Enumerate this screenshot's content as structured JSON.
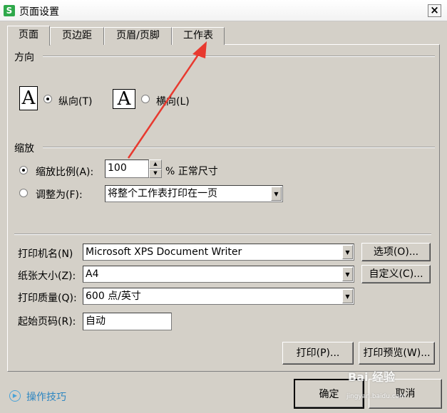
{
  "window": {
    "title": "页面设置",
    "app_icon": "S",
    "close_glyph": "×"
  },
  "tabs": [
    {
      "label": "页面",
      "active": true
    },
    {
      "label": "页边距",
      "active": false
    },
    {
      "label": "页眉/页脚",
      "active": false
    },
    {
      "label": "工作表",
      "active": false
    }
  ],
  "orientation": {
    "section": "方向",
    "icon_letter": "A",
    "portrait": {
      "label": "纵向(T)",
      "selected": true
    },
    "landscape": {
      "label": "横向(L)",
      "selected": false
    }
  },
  "scaling": {
    "section": "缩放",
    "scale": {
      "label": "缩放比例(A):",
      "value": "100",
      "suffix": "% 正常尺寸",
      "selected": true
    },
    "fit": {
      "label": "调整为(F):",
      "value": "将整个工作表打印在一页",
      "selected": false
    }
  },
  "printer": {
    "name_label": "打印机名(N)",
    "name_value": "Microsoft XPS Document Writer",
    "options_button": "选项(O)...",
    "paper_label": "纸张大小(Z):",
    "paper_value": "A4",
    "custom_button": "自定义(C)...",
    "quality_label": "打印质量(Q):",
    "quality_value": "600 点/英寸",
    "start_label": "起始页码(R):",
    "start_value": "自动"
  },
  "actions": {
    "print": "打印(P)...",
    "preview": "打印预览(W)...",
    "ok": "确定",
    "cancel": "取消"
  },
  "help": {
    "label": "操作技巧"
  },
  "watermark": {
    "text": "Bai 经验",
    "sub": "jingyan.baidu.com"
  },
  "colors": {
    "arrow": "#e8392f",
    "dialog_bg": "#d4d0c8",
    "link": "#2e86c1",
    "app_icon": "#2ea84a"
  }
}
